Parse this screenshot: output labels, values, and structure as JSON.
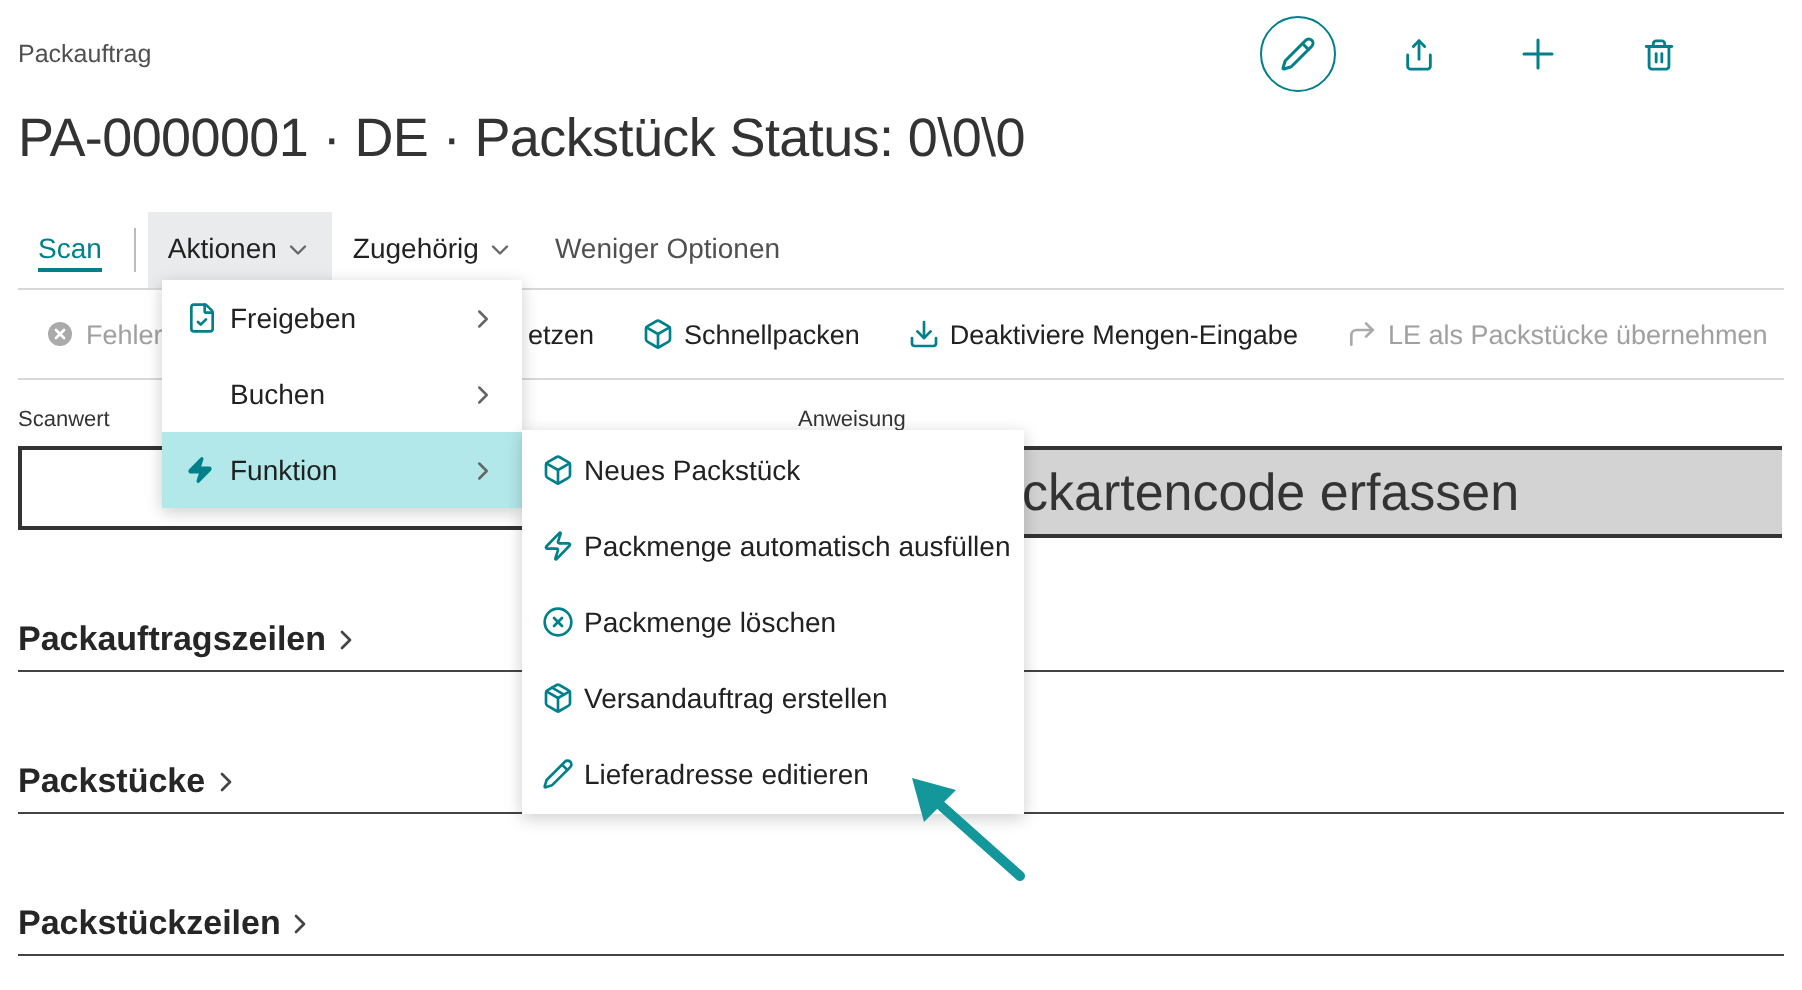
{
  "header": {
    "caption": "Packauftrag",
    "title": "PA-0000001 · DE · Packstück Status: 0\\0\\0"
  },
  "tabs": [
    {
      "label": "Scan",
      "selected": true,
      "expanded": false
    },
    {
      "label": "Aktionen",
      "selected": false,
      "expanded": true
    },
    {
      "label": "Zugehörig",
      "selected": false,
      "expanded": false
    },
    {
      "label": "Weniger Optionen",
      "selected": false,
      "expanded": false
    }
  ],
  "actions": [
    {
      "label": "Fehler",
      "disabled": true
    },
    {
      "label": "etzen",
      "disabled": false
    },
    {
      "label": "Schnellpacken",
      "disabled": false
    },
    {
      "label": "Deaktiviere Mengen-Eingabe",
      "disabled": false
    },
    {
      "label": "LE als Packstücke übernehmen",
      "disabled": true
    }
  ],
  "fields": {
    "scan_label": "Scanwert",
    "instruction_label": "Anweisung",
    "instruction_value": "ckartencode erfassen"
  },
  "sections": [
    "Packauftragszeilen",
    "Packstücke",
    "Packstückzeilen"
  ],
  "menu": [
    {
      "label": "Freigeben",
      "selected": false
    },
    {
      "label": "Buchen",
      "selected": false
    },
    {
      "label": "Funktion",
      "selected": true
    }
  ],
  "submenu": [
    {
      "label": "Neues Packstück"
    },
    {
      "label": "Packmenge automatisch ausfüllen"
    },
    {
      "label": "Packmenge löschen"
    },
    {
      "label": "Versandauftrag erstellen"
    },
    {
      "label": "Lieferadresse editieren"
    }
  ]
}
